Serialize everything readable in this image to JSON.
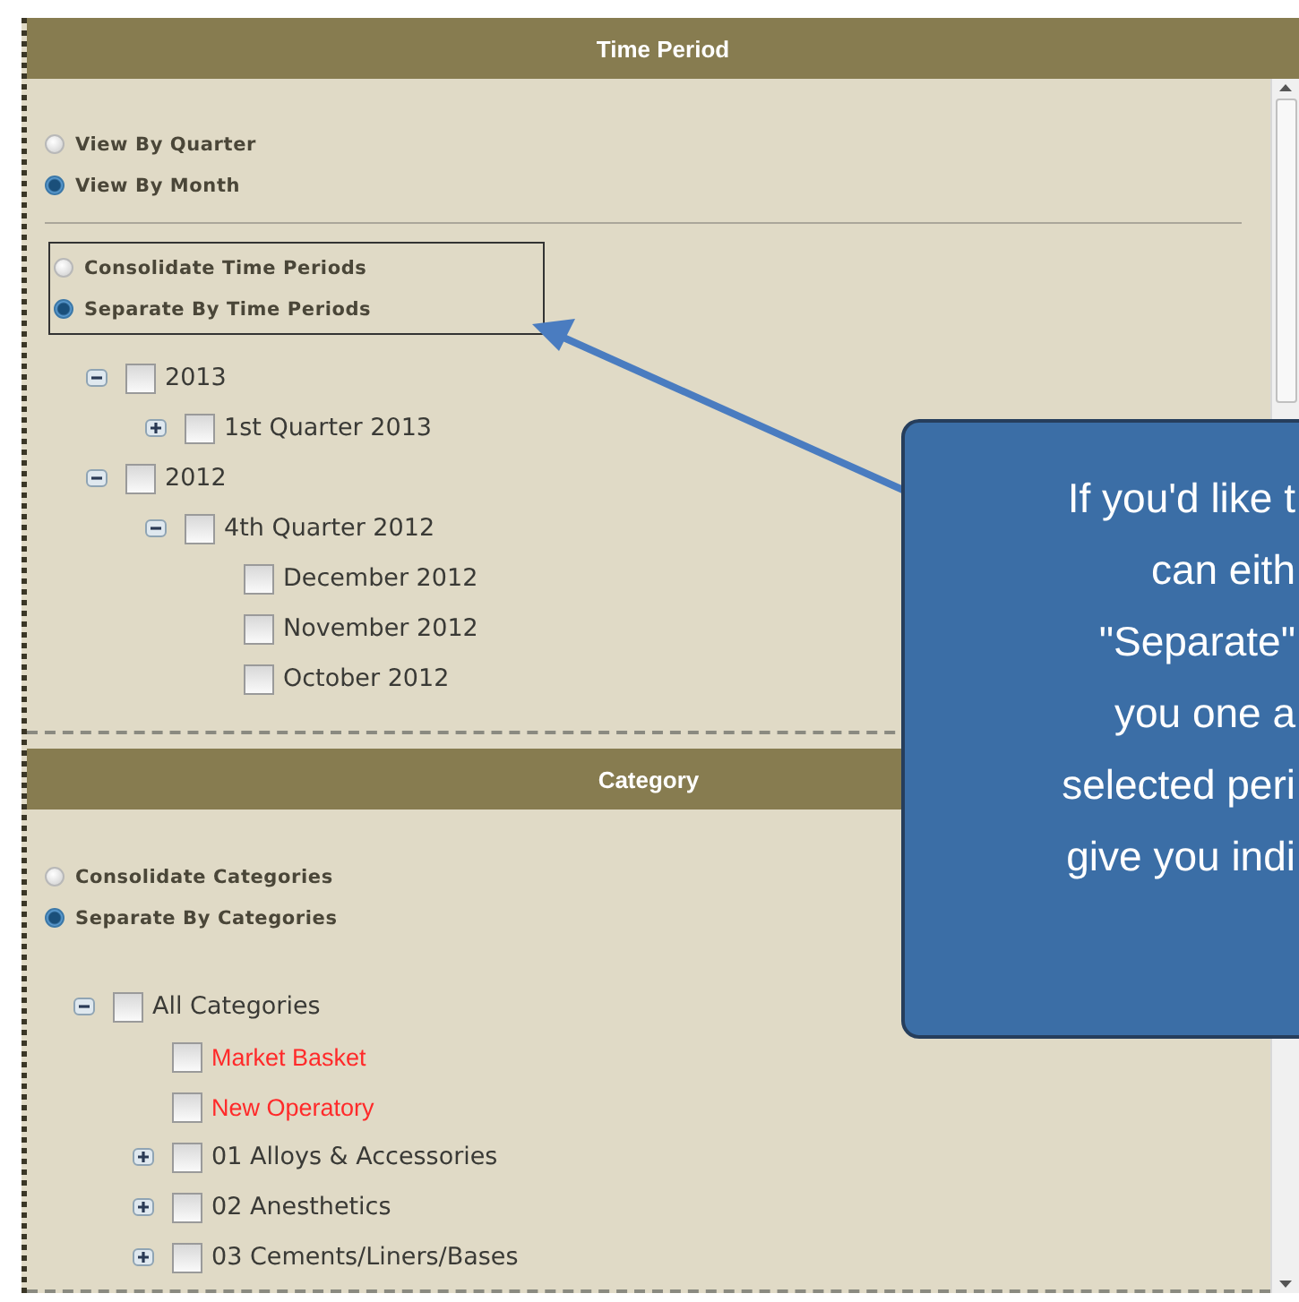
{
  "time_period": {
    "title": "Time Period",
    "view_options": [
      {
        "label": "View By Quarter",
        "selected": false
      },
      {
        "label": "View By Month",
        "selected": true
      }
    ],
    "consolidation_options": [
      {
        "label": "Consolidate Time Periods",
        "selected": false
      },
      {
        "label": "Separate By Time Periods",
        "selected": true
      }
    ],
    "tree": [
      {
        "label": "2013",
        "expanded": true,
        "checked": false,
        "children": [
          {
            "label": "1st Quarter 2013",
            "expanded": false,
            "checked": false
          }
        ]
      },
      {
        "label": "2012",
        "expanded": true,
        "checked": false,
        "children": [
          {
            "label": "4th Quarter 2012",
            "expanded": true,
            "checked": false,
            "children": [
              {
                "label": "December 2012",
                "checked": false
              },
              {
                "label": "November 2012",
                "checked": false
              },
              {
                "label": "October 2012",
                "checked": false
              }
            ]
          }
        ]
      }
    ]
  },
  "category": {
    "title": "Category",
    "consolidation_options": [
      {
        "label": "Consolidate Categories",
        "selected": false
      },
      {
        "label": "Separate By Categories",
        "selected": true
      }
    ],
    "tree": [
      {
        "label": "All Categories",
        "expanded": true,
        "checked": false,
        "children": [
          {
            "label": "Market Basket",
            "checked": false,
            "color": "#ff2a2a"
          },
          {
            "label": "New Operatory",
            "checked": false,
            "color": "#ff2a2a"
          },
          {
            "label": "01 Alloys & Accessories",
            "expanded": false,
            "checked": false
          },
          {
            "label": "02 Anesthetics",
            "expanded": false,
            "checked": false
          },
          {
            "label": "03 Cements/Liners/Bases",
            "expanded": false,
            "checked": false
          }
        ]
      }
    ]
  },
  "callout": {
    "lines": [
      "If you'd like t",
      "can eith",
      "\"Separate\"",
      "you one a",
      "selected peri",
      "give you indi"
    ]
  }
}
